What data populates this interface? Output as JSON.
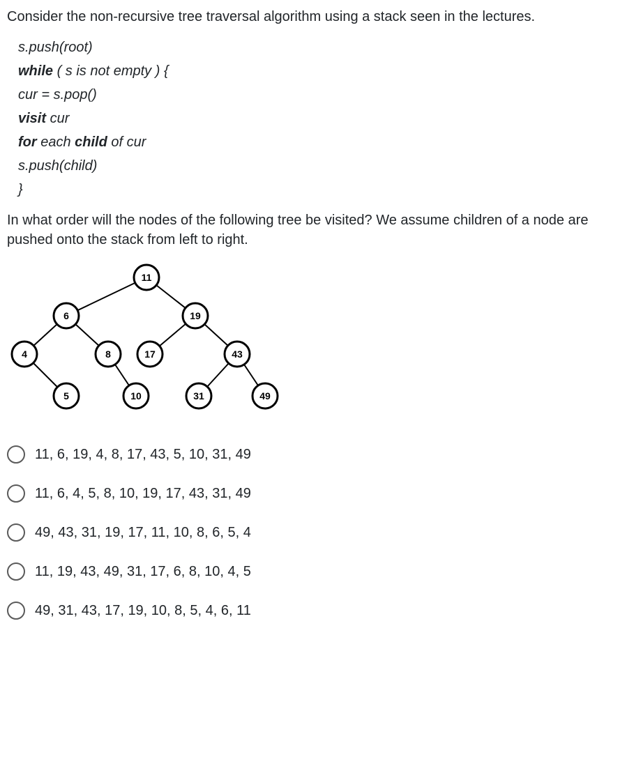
{
  "intro": "Consider the non-recursive tree traversal algorithm using a stack seen in the lectures.",
  "pseudocode": {
    "l1": "s.push(root)",
    "l2a": "while",
    "l2b": " ( s is not empty ) {",
    "l3": "cur = s.pop()",
    "l4a": "visit",
    "l4b": " cur",
    "l5a": "for",
    "l5b": " each ",
    "l5c": "child",
    "l5d": " of cur",
    "l6": "s.push(child)",
    "l7": "}"
  },
  "follow": "In what order will the nodes of the following tree be visited? We assume children of a node are pushed onto the stack from left to right.",
  "tree": {
    "n11": "11",
    "n6": "6",
    "n19": "19",
    "n4": "4",
    "n8": "8",
    "n17": "17",
    "n43": "43",
    "n5": "5",
    "n10": "10",
    "n31": "31",
    "n49": "49"
  },
  "options": {
    "a": "11, 6, 19, 4, 8, 17, 43, 5, 10, 31, 49",
    "b": "11, 6, 4, 5, 8, 10,  19, 17, 43, 31, 49",
    "c": "49, 43, 31, 19, 17, 11, 10, 8, 6, 5, 4",
    "d": "11, 19, 43, 49, 31, 17, 6, 8, 10, 4, 5",
    "e": "49, 31, 43, 17, 19, 10, 8, 5, 4, 6, 11"
  }
}
